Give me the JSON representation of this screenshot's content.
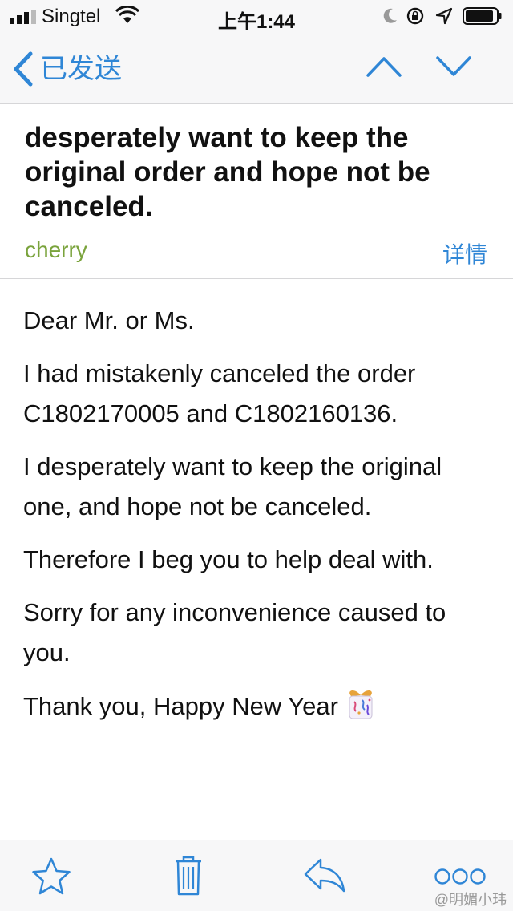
{
  "status_bar": {
    "carrier": "Singtel",
    "time": "上午1:44"
  },
  "nav": {
    "back_label": "已发送",
    "icons": [
      "chevron-left-icon",
      "chevron-up-icon",
      "chevron-down-icon"
    ]
  },
  "email": {
    "subject": "desperately want to keep the original order and hope not be canceled.",
    "sender": "cherry",
    "details_label": "详情",
    "paragraphs": [
      "Dear Mr. or Ms.",
      "I had mistakenly canceled the order C1802170005 and C1802160136.",
      "I desperately want to keep the original one, and hope not be canceled.",
      "Therefore I beg you to help deal with.",
      "Sorry for any inconvenience caused to you.",
      "Thank you, Happy New Year"
    ]
  },
  "toolbar": {
    "icons": [
      "star-icon",
      "trash-icon",
      "reply-icon",
      "more-icon"
    ]
  },
  "watermark": "@明媚小玮",
  "colors": {
    "accent": "#2f86d6",
    "sender": "#7aa33c",
    "bar_bg": "#f7f7f8"
  }
}
